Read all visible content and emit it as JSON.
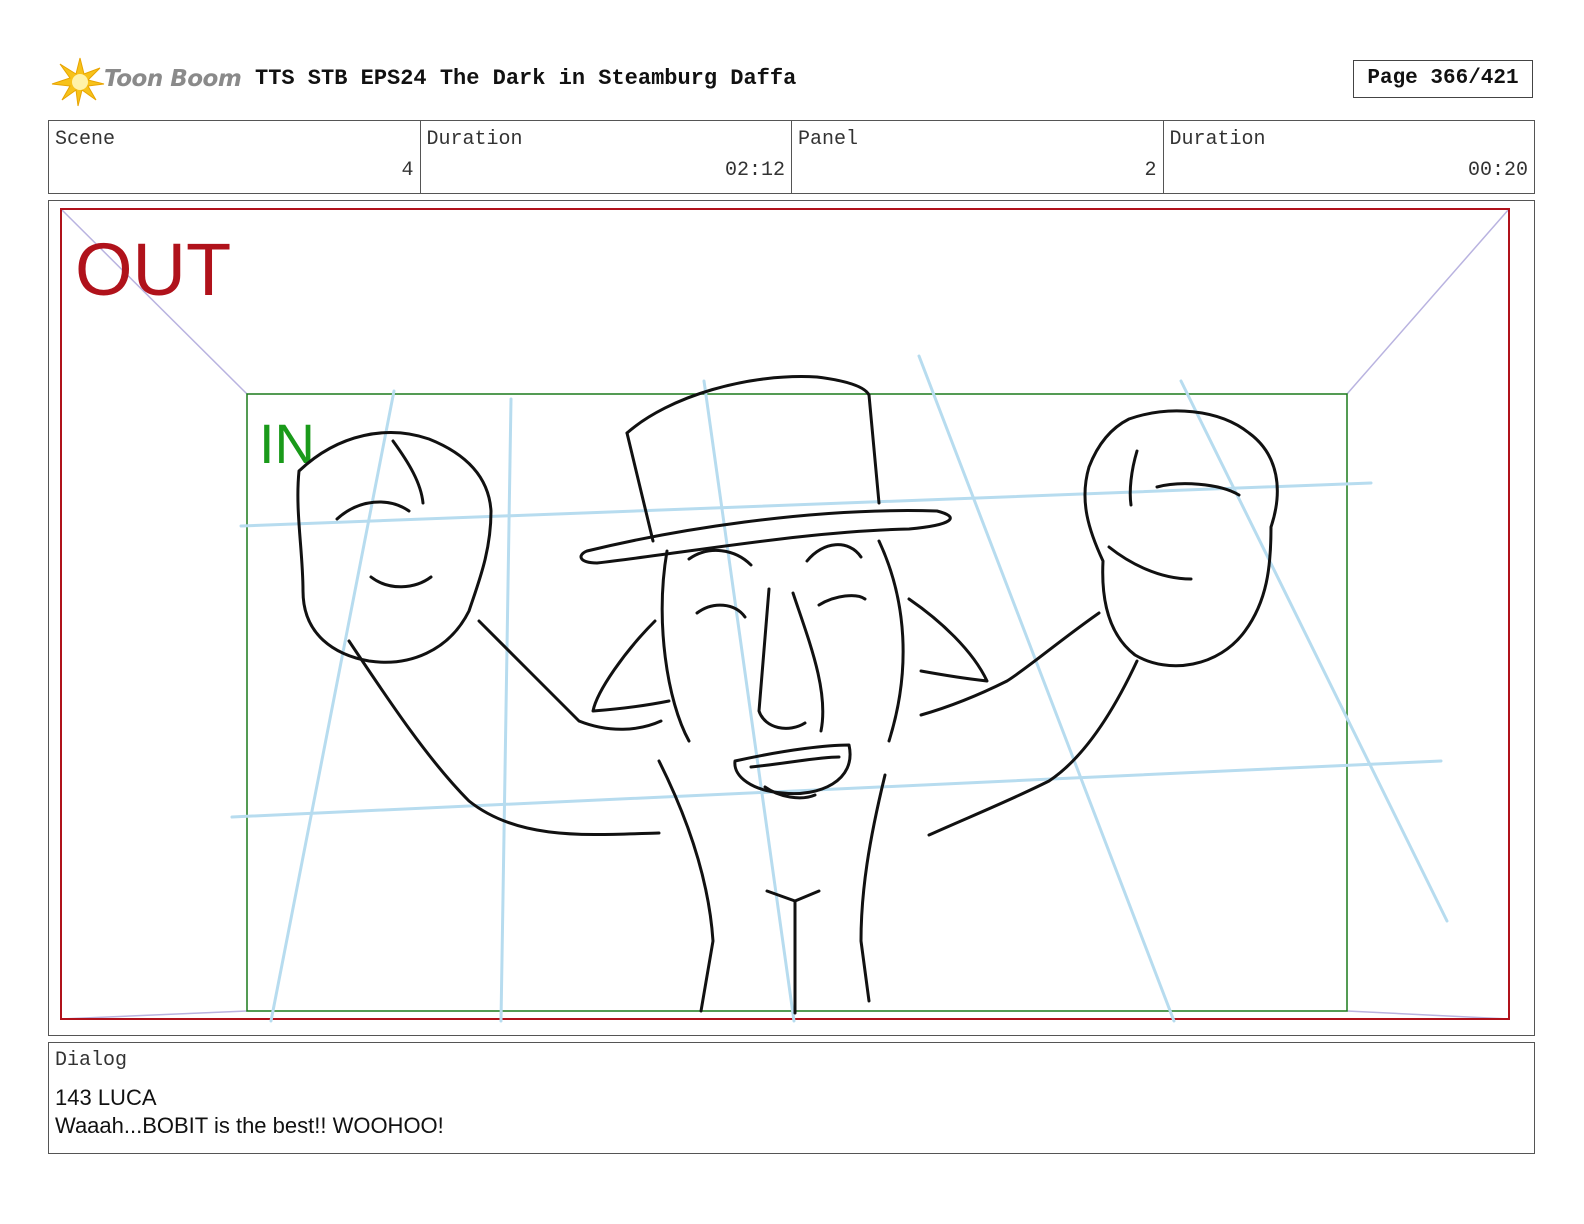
{
  "header": {
    "logo_text": "Toon Boom",
    "title": "TTS STB EPS24 The Dark in Steamburg Daffa",
    "page": "Page 366/421"
  },
  "meta": {
    "scene_label": "Scene",
    "scene_value": "4",
    "scene_duration_label": "Duration",
    "scene_duration_value": "02:12",
    "panel_label": "Panel",
    "panel_value": "2",
    "panel_duration_label": "Duration",
    "panel_duration_value": "00:20"
  },
  "panel": {
    "out_label": "OUT",
    "in_label": "IN",
    "out_color": "#b0121b",
    "in_color": "#1a9a1a"
  },
  "dialog": {
    "label": "Dialog",
    "lines": [
      "143 LUCA",
      "Waaah...BOBIT is the best!! WOOHOO!"
    ]
  }
}
